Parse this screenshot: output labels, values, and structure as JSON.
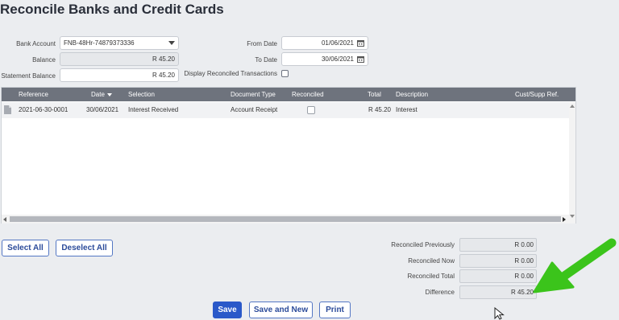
{
  "page": {
    "title": "Reconcile Banks and Credit Cards"
  },
  "form": {
    "bank_account_label": "Bank Account",
    "bank_account_value": "FNB-48Hr-74879373336",
    "balance_label": "Balance",
    "balance_value": "R 45.20",
    "statement_balance_label": "Statement Balance",
    "statement_balance_value": "R 45.20",
    "from_date_label": "From Date",
    "from_date_value": "01/06/2021",
    "to_date_label": "To Date",
    "to_date_value": "30/06/2021",
    "display_reconciled_label": "Display Reconciled Transactions"
  },
  "grid": {
    "columns": {
      "reference": "Reference",
      "date": "Date",
      "selection": "Selection",
      "document_type": "Document Type",
      "reconciled": "Reconciled",
      "total": "Total",
      "description": "Description",
      "cust_supp_ref": "Cust/Supp Ref."
    },
    "rows": [
      {
        "reference": "2021-06-30-0001",
        "date": "30/06/2021",
        "selection": "Interest Received",
        "document_type": "Account Receipt",
        "total": "R 45.20",
        "description": "Interest"
      }
    ]
  },
  "actions": {
    "select_all": "Select All",
    "deselect_all": "Deselect All",
    "save": "Save",
    "save_and_new": "Save and New",
    "print": "Print"
  },
  "summary": {
    "reconciled_previously_label": "Reconciled Previously",
    "reconciled_previously_value": "R 0.00",
    "reconciled_now_label": "Reconciled Now",
    "reconciled_now_value": "R 0.00",
    "reconciled_total_label": "Reconciled Total",
    "reconciled_total_value": "R 0.00",
    "difference_label": "Difference",
    "difference_value": "R 45.20"
  },
  "colors": {
    "accent": "#2a59c9",
    "annotation_arrow": "#3bc41b",
    "grid_header": "#6e737d"
  },
  "icons": [
    "calendar-icon",
    "dropdown-arrow-icon",
    "document-icon",
    "sort-desc-icon",
    "mouse-pointer-icon",
    "annotation-arrow"
  ]
}
